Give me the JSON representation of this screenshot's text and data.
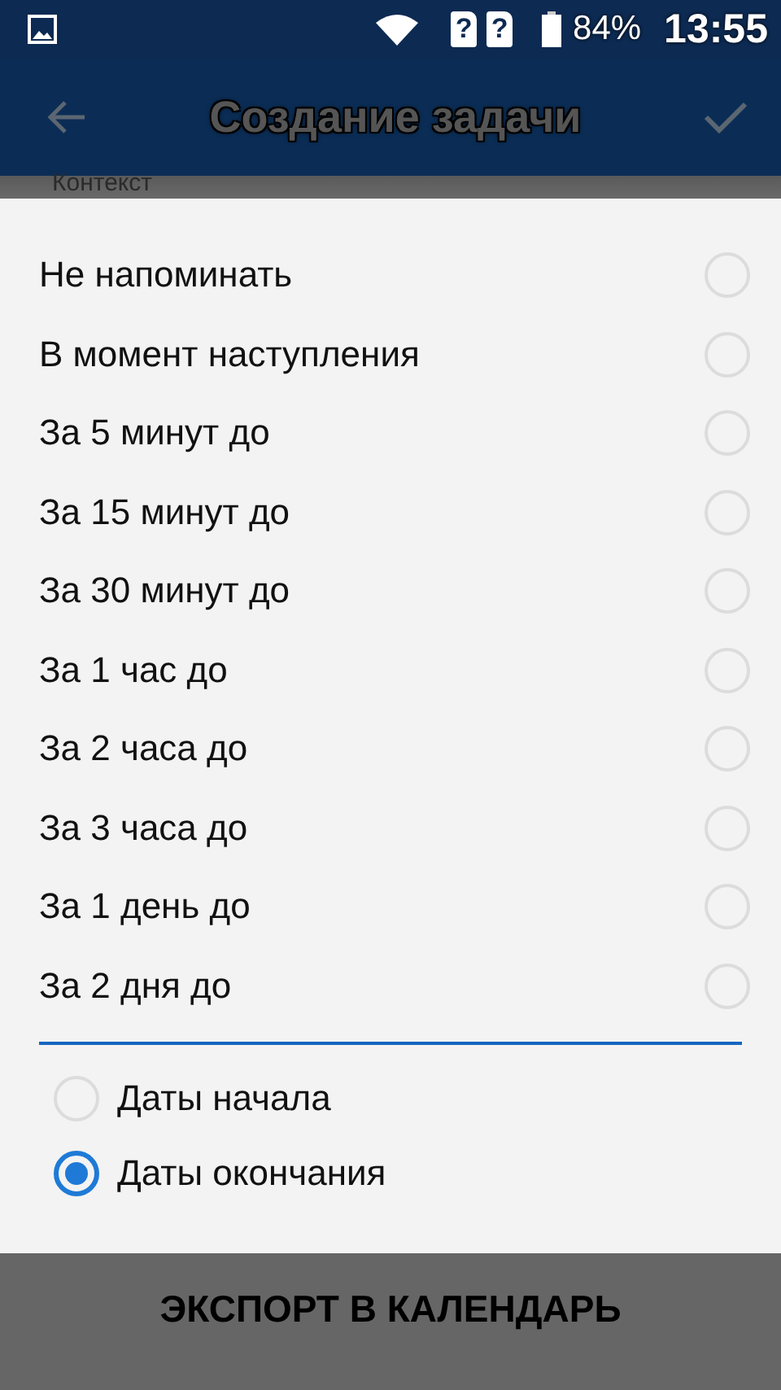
{
  "status_bar": {
    "sim_marks": [
      "?",
      "?"
    ],
    "battery": "84%",
    "time": "13:55"
  },
  "app_bar": {
    "title": "Создание задачи"
  },
  "background_text": "Контекст",
  "reminder_options": [
    {
      "label": "Не напоминать",
      "selected": false
    },
    {
      "label": "В момент наступления",
      "selected": false
    },
    {
      "label": "За 5 минут до",
      "selected": false
    },
    {
      "label": "За 15 минут до",
      "selected": false
    },
    {
      "label": "За 30 минут до",
      "selected": false
    },
    {
      "label": "За 1 час до",
      "selected": false
    },
    {
      "label": "За 2 часа до",
      "selected": false
    },
    {
      "label": "За 3 часа до",
      "selected": false
    },
    {
      "label": "За 1 день до",
      "selected": false
    },
    {
      "label": "За 2 дня до",
      "selected": false
    }
  ],
  "relative_to": [
    {
      "label": "Даты начала",
      "selected": false
    },
    {
      "label": "Даты окончания",
      "selected": true
    }
  ],
  "export_button": "ЭКСПОРТ В КАЛЕНДАРЬ"
}
